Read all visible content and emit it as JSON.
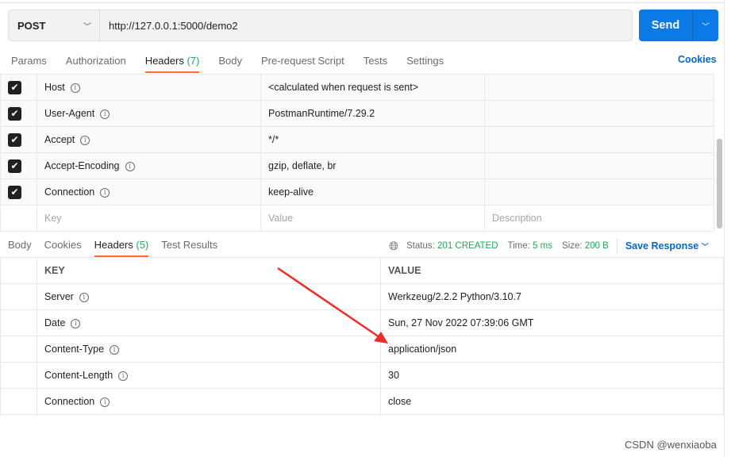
{
  "request": {
    "method": "POST",
    "url": "http://127.0.0.1:5000/demo2",
    "send_label": "Send",
    "tabs": [
      {
        "label": "Params"
      },
      {
        "label": "Authorization"
      },
      {
        "label": "Headers",
        "count": "(7)"
      },
      {
        "label": "Body"
      },
      {
        "label": "Pre-request Script"
      },
      {
        "label": "Tests"
      },
      {
        "label": "Settings"
      }
    ],
    "cookies_label": "Cookies",
    "headers": [
      {
        "key": "Host",
        "value": "<calculated when request is sent>"
      },
      {
        "key": "User-Agent",
        "value": "PostmanRuntime/7.29.2"
      },
      {
        "key": "Accept",
        "value": "*/*"
      },
      {
        "key": "Accept-Encoding",
        "value": "gzip, deflate, br"
      },
      {
        "key": "Connection",
        "value": "keep-alive"
      }
    ],
    "placeholders": {
      "key": "Key",
      "value": "Value",
      "description": "Description"
    }
  },
  "response": {
    "tabs": [
      {
        "label": "Body"
      },
      {
        "label": "Cookies"
      },
      {
        "label": "Headers",
        "count": "(5)"
      },
      {
        "label": "Test Results"
      }
    ],
    "status_label": "Status:",
    "status": "201 CREATED",
    "time_label": "Time:",
    "time": "5 ms",
    "size_label": "Size:",
    "size": "200 B",
    "save_label": "Save Response",
    "columns": {
      "key": "KEY",
      "value": "VALUE"
    },
    "headers": [
      {
        "key": "Server",
        "value": "Werkzeug/2.2.2 Python/3.10.7"
      },
      {
        "key": "Date",
        "value": "Sun, 27 Nov 2022 07:39:06 GMT"
      },
      {
        "key": "Content-Type",
        "value": "application/json"
      },
      {
        "key": "Content-Length",
        "value": "30"
      },
      {
        "key": "Connection",
        "value": "close"
      }
    ]
  },
  "watermark": "CSDN @wenxiaoba",
  "colors": {
    "accent": "#0b7ae6",
    "tab_underline": "#ff6c37",
    "status_green": "#26a65b",
    "arrow": "#f22a2a"
  }
}
